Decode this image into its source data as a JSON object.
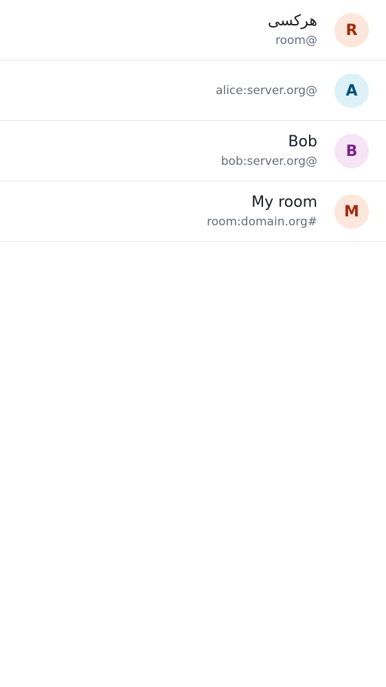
{
  "rows": [
    {
      "name": "هرکسی",
      "subtitle": "room@",
      "initial": "R",
      "avatar_bg": "#fde6dc",
      "avatar_fg": "#a52a0b"
    },
    {
      "name": "",
      "subtitle": "alice:server.org@",
      "initial": "A",
      "avatar_bg": "#dcf1f8",
      "avatar_fg": "#04507a"
    },
    {
      "name": "Bob",
      "subtitle": "bob:server.org@",
      "initial": "B",
      "avatar_bg": "#f6e4f7",
      "avatar_fg": "#7b248a"
    },
    {
      "name": "My room",
      "subtitle": "room:domain.org#",
      "initial": "M",
      "avatar_bg": "#fde6dc",
      "avatar_fg": "#a52a0b"
    }
  ]
}
